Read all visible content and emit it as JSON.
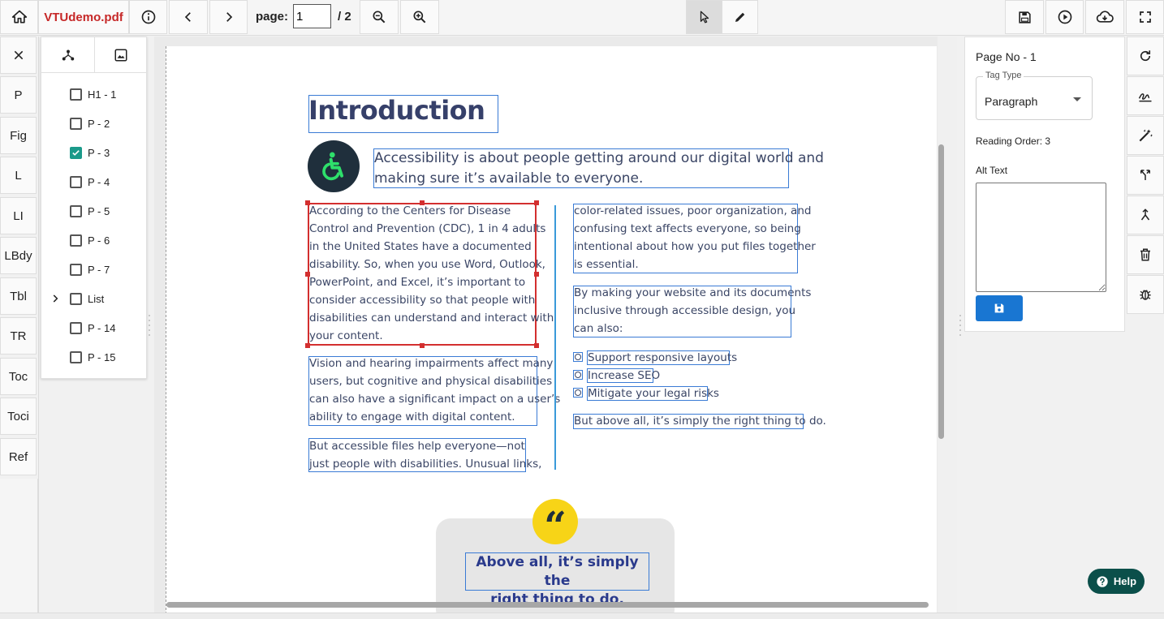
{
  "toolbar": {
    "filename": "VTUdemo.pdf",
    "page_label": "page:",
    "page_value": "1",
    "page_total": "/ 2"
  },
  "tag_buttons": [
    "P",
    "Fig",
    "L",
    "LI",
    "LBdy",
    "Tbl",
    "TR",
    "Toc",
    "Toci",
    "Ref"
  ],
  "tree": {
    "items": [
      {
        "label": "H1 - 1",
        "checked": false
      },
      {
        "label": "P - 2",
        "checked": false
      },
      {
        "label": "P - 3",
        "checked": true
      },
      {
        "label": "P - 4",
        "checked": false
      },
      {
        "label": "P - 5",
        "checked": false
      },
      {
        "label": "P - 6",
        "checked": false
      },
      {
        "label": "P - 7",
        "checked": false
      },
      {
        "label": "List",
        "checked": false,
        "expandable": true
      },
      {
        "label": "P - 14",
        "checked": false
      },
      {
        "label": "P - 15",
        "checked": false
      }
    ]
  },
  "document": {
    "heading": "Introduction",
    "intro_line1": "Accessibility is about people getting around our digital world and",
    "intro_line2": "making sure it’s available to everyone.",
    "p3": [
      "According to the Centers for Disease",
      "Control and Prevention (CDC), 1 in 4 adults",
      "in the United States have a documented",
      "disability. So, when you use Word, Outlook,",
      "PowerPoint, and Excel, it’s important to",
      "consider accessibility so that people with",
      "disabilities can understand and interact with",
      "your content."
    ],
    "p4": [
      "Vision and hearing impairments affect many",
      "users, but cognitive and physical disabilities",
      "can also have a significant impact on a user’s",
      "ability to engage with digital content."
    ],
    "p5": [
      "But accessible files help everyone—not",
      "just people with disabilities. Unusual links,"
    ],
    "p6": [
      "color-related issues, poor organization, and",
      "confusing text affects everyone, so being",
      "intentional about how you put files together",
      "is essential."
    ],
    "p7": [
      "By making your website and its documents",
      "inclusive through accessible design, you",
      "can also:"
    ],
    "list": [
      "Support responsive layouts",
      "Increase SEO",
      "Mitigate your legal risks"
    ],
    "p14": "But above all, it’s simply the right thing to do.",
    "quote_line1": "Above all, it’s simply the",
    "quote_line2": "right thing to do.",
    "quote_mark": "“"
  },
  "properties": {
    "page_no": "Page No - 1",
    "tag_type_label": "Tag Type",
    "tag_type_value": "Paragraph",
    "reading_order": "Reading Order: 3",
    "alt_text_label": "Alt Text",
    "alt_text_value": ""
  },
  "help": {
    "label": "Help"
  },
  "colors": {
    "accent_blue": "#1976d2",
    "check_teal": "#1b9a8a",
    "filename_red": "#c62828",
    "help_green": "#0b4f4a",
    "quote_yellow": "#f7d417"
  }
}
